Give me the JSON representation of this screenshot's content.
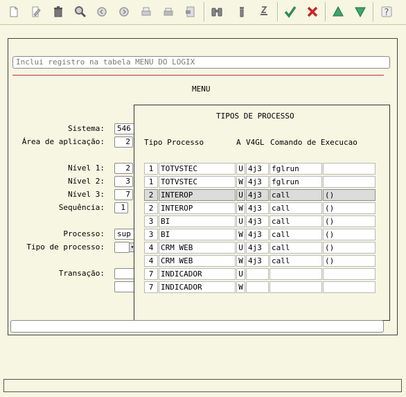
{
  "message": "Inclui registro na tabela MENU DO LOGIX",
  "form": {
    "title": "MENU",
    "sistema_label": "Sistema:",
    "sistema_value": "546",
    "area_label": "Área de aplicação:",
    "area_value": "2",
    "nivel1_label": "Nível 1:",
    "nivel1_value": "2",
    "nivel2_label": "Nível 2:",
    "nivel2_value": "3",
    "nivel3_label": "Nível 3:",
    "nivel3_value": "7",
    "sequencia_label": "Sequência:",
    "sequencia_value": "1",
    "processo_label": "Processo:",
    "processo_value": "sup",
    "tipo_processo_label": "Tipo de processo:",
    "transacao_label": "Transação:"
  },
  "popup": {
    "title": "TIPOS DE PROCESSO",
    "col_tipo": "Tipo Processo",
    "col_a": "A",
    "col_v4gl": "V4GL",
    "col_cmd": "Comando de Execucao",
    "rows": [
      {
        "num": "1",
        "name": "TOTVSTEC",
        "a": "U",
        "v4gl": "4j3",
        "cmd": "fglrun",
        "extra": ""
      },
      {
        "num": "1",
        "name": "TOTVSTEC",
        "a": "W",
        "v4gl": "4j3",
        "cmd": "fglrun",
        "extra": ""
      },
      {
        "num": "2",
        "name": "INTEROP",
        "a": "U",
        "v4gl": "4j3",
        "cmd": "call",
        "extra": "()"
      },
      {
        "num": "2",
        "name": "INTEROP",
        "a": "W",
        "v4gl": "4j3",
        "cmd": "call",
        "extra": "()"
      },
      {
        "num": "3",
        "name": "BI",
        "a": "U",
        "v4gl": "4j3",
        "cmd": "call",
        "extra": "()"
      },
      {
        "num": "3",
        "name": "BI",
        "a": "W",
        "v4gl": "4j3",
        "cmd": "call",
        "extra": "()"
      },
      {
        "num": "4",
        "name": "CRM WEB",
        "a": "U",
        "v4gl": "4j3",
        "cmd": "call",
        "extra": "()"
      },
      {
        "num": "4",
        "name": "CRM WEB",
        "a": "W",
        "v4gl": "4j3",
        "cmd": "call",
        "extra": "()"
      },
      {
        "num": "7",
        "name": "INDICADOR",
        "a": "U",
        "v4gl": "",
        "cmd": "",
        "extra": ""
      },
      {
        "num": "7",
        "name": "INDICADOR",
        "a": "W",
        "v4gl": "",
        "cmd": "",
        "extra": ""
      }
    ],
    "selected_row": 2
  },
  "toolbar": {
    "icons": [
      "new-icon",
      "edit-icon",
      "delete-icon",
      "find-icon",
      "previous-icon",
      "next-icon",
      "print-icon",
      "print-setup-icon",
      "export-icon",
      "binoculars-icon",
      "info-icon",
      "zoom-icon",
      "confirm-icon",
      "cancel-icon",
      "scroll-up-icon",
      "scroll-down-icon",
      "help-icon"
    ]
  },
  "colors": {
    "background": "#f7f6e2",
    "selected_row": "#dcdcdc",
    "confirm": "#2e8b57",
    "cancel": "#cc2222",
    "accent_red_line": "#b33333"
  }
}
